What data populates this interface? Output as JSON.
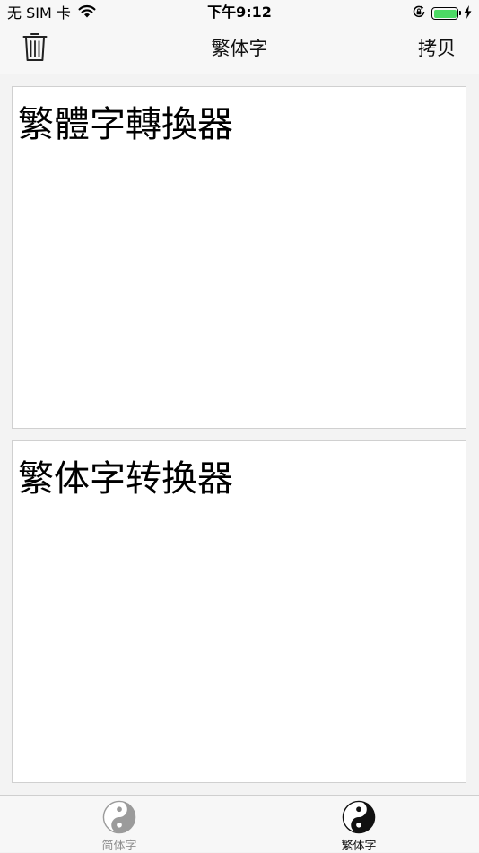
{
  "status_bar": {
    "carrier": "无 SIM 卡",
    "time": "下午9:12",
    "battery_level": 1.0,
    "battery_color": "#4cd964"
  },
  "nav_bar": {
    "title": "繁体字",
    "left_icon": "trash-icon",
    "copy_label": "拷贝"
  },
  "panes": {
    "traditional_text": "繁體字轉換器",
    "simplified_text": "繁体字转换器"
  },
  "tab_bar": {
    "tabs": [
      {
        "label": "简体字",
        "icon": "yin-yang-icon",
        "selected": false,
        "color": "#9b9b9b"
      },
      {
        "label": "繁体字",
        "icon": "yin-yang-icon",
        "selected": true,
        "color": "#111111"
      }
    ]
  }
}
